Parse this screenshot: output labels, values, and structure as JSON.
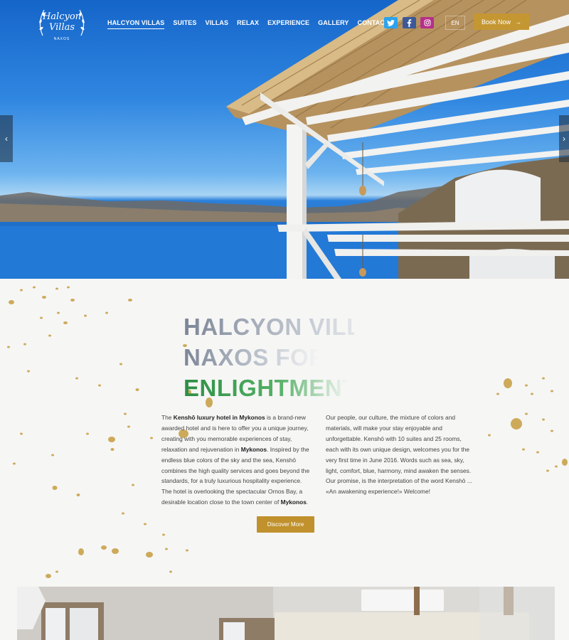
{
  "brand": {
    "line1": "Halcyon",
    "line2": "Villas",
    "line3": "NAXOS"
  },
  "nav": [
    "HALCYON VILLAS",
    "SUITES",
    "VILLAS",
    "RELAX",
    "EXPERIENCE",
    "GALLERY",
    "CONTACT"
  ],
  "social": {
    "twitter": "twitter-icon",
    "facebook": "facebook-icon",
    "instagram": "instagram-icon"
  },
  "lang": "EN",
  "book": {
    "label": "Book Now",
    "arrow": "→"
  },
  "hero": {
    "prev": "‹",
    "next": "›"
  },
  "colors": {
    "gold": "#c59732",
    "twitter": "#2aa3ef",
    "facebook": "#3b5998",
    "instagram": "#b62f8a"
  },
  "about": {
    "title1": "HALCYON VILLAS",
    "title2": "NAXOS FOR",
    "title3": "ENLIGHTMENT",
    "col1": {
      "t1": "The ",
      "b1": "Kenshō luxury hotel in Mykonos",
      "t2": " is a brand-new awarded hotel and is here to offer you a unique journey, creating with you memorable experiences of stay, relaxation and rejuvenation in ",
      "b2": "Mykonos",
      "t3": ". Inspired by the endless blue colors of the sky and the sea, Kenshō combines the high quality services and goes beyond the standards, for a truly luxurious hospitality experience. The hotel is overlooking the spectacular Ornos Bay, a desirable location close to the town center of ",
      "b3": "Mykonos",
      "t4": "."
    },
    "col2": "Our people, our culture, the mixture of colors and materials, will make your stay enjoyable and unforgettable. Kenshō with 10 suites and 25 rooms, each with its own unique design, welcomes you for the very first time in June 2016. Words such as sea, sky, light, comfort, blue, harmony, mind awaken the senses. Our promise, is the interpretation of the word Kenshō ... «An awakening experience!» Welcome!",
    "button": "Discover More"
  }
}
